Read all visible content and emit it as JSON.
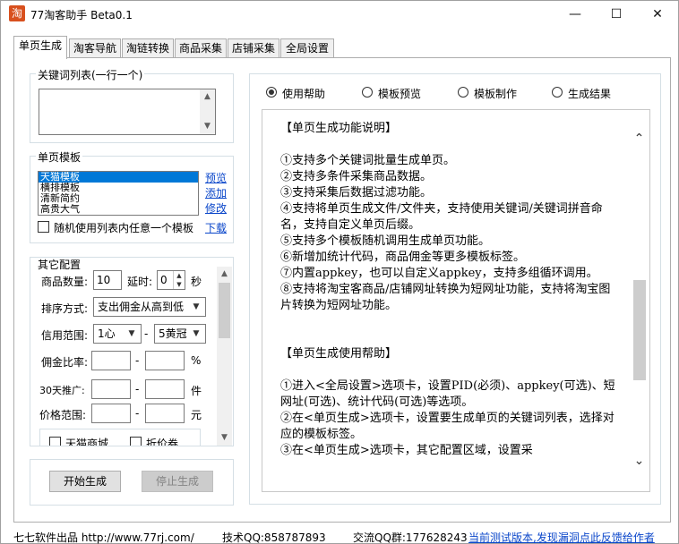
{
  "window": {
    "icon_glyph": "淘",
    "title": "77淘客助手 Beta0.1",
    "controls": {
      "minimize": "—",
      "maximize": "☐",
      "close": "✕"
    }
  },
  "tabs": [
    "单页生成",
    "淘客导航",
    "淘链转换",
    "商品采集",
    "店铺采集",
    "全局设置"
  ],
  "keywords": {
    "title": "关键词列表(一行一个)",
    "value": ""
  },
  "template": {
    "title": "单页模板",
    "items": [
      "天猫模板",
      "横排模板",
      "清新简约",
      "高贵大气"
    ],
    "selected_index": 0,
    "links": [
      "预览",
      "添加",
      "修改",
      "下载"
    ],
    "random_label": "随机使用列表内任意一个模板"
  },
  "other_config": {
    "title": "其它配置",
    "count_label": "商品数量:",
    "count_value": "10",
    "delay_label": "延时:",
    "delay_value": "0",
    "delay_unit": "秒",
    "sort_label": "排序方式:",
    "sort_value": "支出佣金从高到低",
    "credit_label": "信用范围:",
    "credit_from": "1心",
    "credit_dash": "-",
    "credit_to": "5黄冠",
    "commission_label": "佣金比率:",
    "commission_dash": "-",
    "commission_unit": "%",
    "promo_label": "30天推广:",
    "promo_dash": "-",
    "promo_unit": "件",
    "price_label": "价格范围:",
    "price_dash": "-",
    "price_unit": "元",
    "filter_tmall": "天猫商城",
    "filter_discount": "折价券"
  },
  "actions": {
    "start": "开始生成",
    "stop": "停止生成"
  },
  "radios": {
    "options": [
      "使用帮助",
      "模板预览",
      "模板制作",
      "生成结果"
    ],
    "selected_index": 0
  },
  "help": {
    "content": "【单页生成功能说明】\n\n①支持多个关键词批量生成单页。\n②支持多条件采集商品数据。\n③支持采集后数据过滤功能。\n④支持将单页生成文件/文件夹，支持使用关键词/关键词拼音命名，支持自定义单页后缀。\n⑤支持多个模板随机调用生成单页功能。\n⑥新增加统计代码，商品佣金等更多模板标签。\n⑦内置appkey，也可以自定义appkey，支持多组循环调用。\n⑧支持将淘宝客商品/店铺网址转换为短网址功能，支持将淘宝图片转换为短网址功能。\n\n\n【单页生成使用帮助】\n\n①进入<全局设置>选项卡，设置PID(必须)、appkey(可选)、短网址(可选)、统计代码(可选)等选项。\n②在<单页生成>选项卡，设置要生成单页的关键词列表，选择对应的模板标签。\n③在<单页生成>选项卡，其它配置区域，设置采"
  },
  "statusbar": {
    "vendor": "七七软件出品 http://www.77rj.com/",
    "qq": "技术QQ:858787893",
    "group": "交流QQ群:177628243",
    "notice": "当前测试版本,发现漏洞点此反馈给作者"
  },
  "colors": {
    "link": "#0a46ca",
    "selection": "#0078d7",
    "app_icon": "#d8501e"
  }
}
